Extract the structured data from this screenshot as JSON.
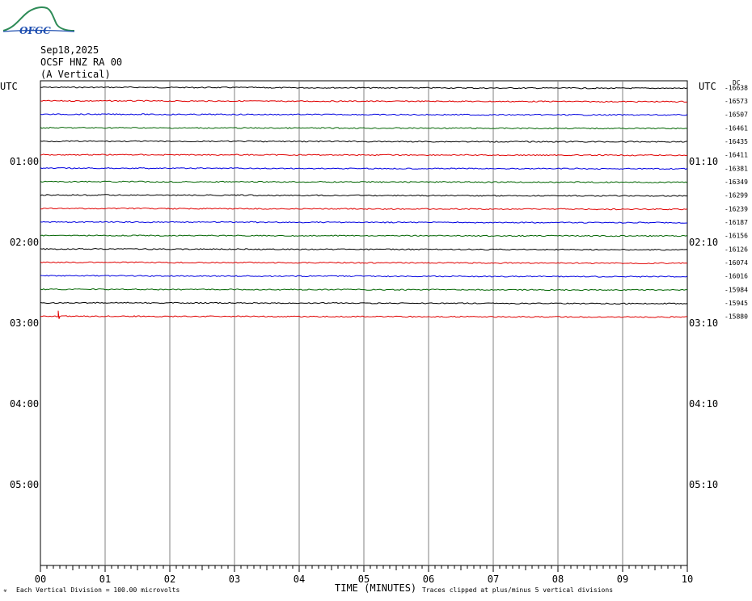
{
  "logo": {
    "text": "OFGC"
  },
  "header": {
    "date": "Sep18,2025",
    "station": "OCSF HNZ RA 00",
    "component": "(A Vertical)"
  },
  "chart_data": {
    "type": "line",
    "title": "",
    "xlabel": "TIME (MINUTES)",
    "ylabel": "",
    "xlim": [
      0,
      10
    ],
    "x_ticks": [
      "00",
      "01",
      "02",
      "03",
      "04",
      "05",
      "06",
      "07",
      "08",
      "09",
      "10"
    ],
    "left_axis_title": "UTC",
    "right_axis_title": "UTC",
    "left_row_labels": [
      {
        "row": 6,
        "text": "01:00"
      },
      {
        "row": 12,
        "text": "02:00"
      },
      {
        "row": 18,
        "text": "03:00"
      },
      {
        "row": 24,
        "text": "04:00"
      },
      {
        "row": 30,
        "text": "05:00"
      }
    ],
    "right_row_labels": [
      {
        "row": 6,
        "text": "01:10"
      },
      {
        "row": 12,
        "text": "02:10"
      },
      {
        "row": 18,
        "text": "03:10"
      },
      {
        "row": 24,
        "text": "04:10"
      },
      {
        "row": 30,
        "text": "05:10"
      }
    ],
    "rows_total": 36,
    "dc_header": "DC",
    "trace_colors": [
      "#000000",
      "#e00000",
      "#0000e0",
      "#006400"
    ],
    "series": [
      {
        "dc": "-16638",
        "color": "#000000",
        "offsets": [
          -0.2,
          0,
          0.3,
          0.5,
          0.7,
          0.9
        ]
      },
      {
        "dc": "-16573",
        "color": "#e00000",
        "offsets": [
          -0.1,
          0.1,
          0.3,
          0.4,
          0.6,
          0.8
        ]
      },
      {
        "dc": "-16507",
        "color": "#0000e0",
        "offsets": [
          -0.2,
          0,
          0.1,
          0.3,
          0.5,
          0.6
        ]
      },
      {
        "dc": "-16461",
        "color": "#006400",
        "offsets": [
          -0.1,
          0.1,
          0.2,
          0.3,
          0.5,
          0.6
        ]
      },
      {
        "dc": "-16435",
        "color": "#000000",
        "offsets": [
          -0.1,
          0,
          0.1,
          0.3,
          0.4,
          0.5
        ]
      },
      {
        "dc": "-16411",
        "color": "#e00000",
        "offsets": [
          -0.1,
          0,
          0.1,
          0.2,
          0.4,
          0.5
        ]
      },
      {
        "dc": "-16381",
        "color": "#0000e0",
        "offsets": [
          -0.1,
          0,
          0.2,
          0.3,
          0.4,
          0.6
        ]
      },
      {
        "dc": "-16349",
        "color": "#006400",
        "offsets": [
          -0.1,
          0.1,
          0.2,
          0.3,
          0.5,
          0.6
        ]
      },
      {
        "dc": "-16299",
        "color": "#000000",
        "offsets": [
          -0.2,
          0,
          0.2,
          0.4,
          0.6,
          0.8
        ]
      },
      {
        "dc": "-16239",
        "color": "#e00000",
        "offsets": [
          -0.2,
          0,
          0.2,
          0.4,
          0.5,
          0.7
        ]
      },
      {
        "dc": "-16187",
        "color": "#0000e0",
        "offsets": [
          -0.1,
          0,
          0.2,
          0.3,
          0.5,
          0.6
        ]
      },
      {
        "dc": "-16156",
        "color": "#006400",
        "offsets": [
          -0.1,
          0,
          0.1,
          0.2,
          0.3,
          0.4
        ]
      },
      {
        "dc": "-16126",
        "color": "#000000",
        "offsets": [
          -0.1,
          0.1,
          0.3,
          0.4,
          0.6,
          0.8
        ]
      },
      {
        "dc": "-16074",
        "color": "#e00000",
        "offsets": [
          -0.2,
          0,
          0.2,
          0.4,
          0.6,
          0.8
        ]
      },
      {
        "dc": "-16016",
        "color": "#0000e0",
        "offsets": [
          -0.2,
          0,
          0.2,
          0.4,
          0.6,
          0.8
        ]
      },
      {
        "dc": "-15984",
        "color": "#006400",
        "offsets": [
          -0.1,
          0.1,
          0.2,
          0.3,
          0.5,
          0.6
        ]
      },
      {
        "dc": "-15945",
        "color": "#000000",
        "offsets": [
          -0.2,
          0,
          0.2,
          0.4,
          0.6,
          0.8
        ]
      },
      {
        "dc": "-15880",
        "color": "#e00000",
        "offsets": [
          -0.2,
          0,
          0.2,
          0.4,
          0.6,
          0.8
        ]
      }
    ],
    "footer_left": "Each Vertical Division =  100.00 microvolts",
    "footer_right": "Traces clipped at plus/minus 5 vertical divisions",
    "grid": true
  }
}
